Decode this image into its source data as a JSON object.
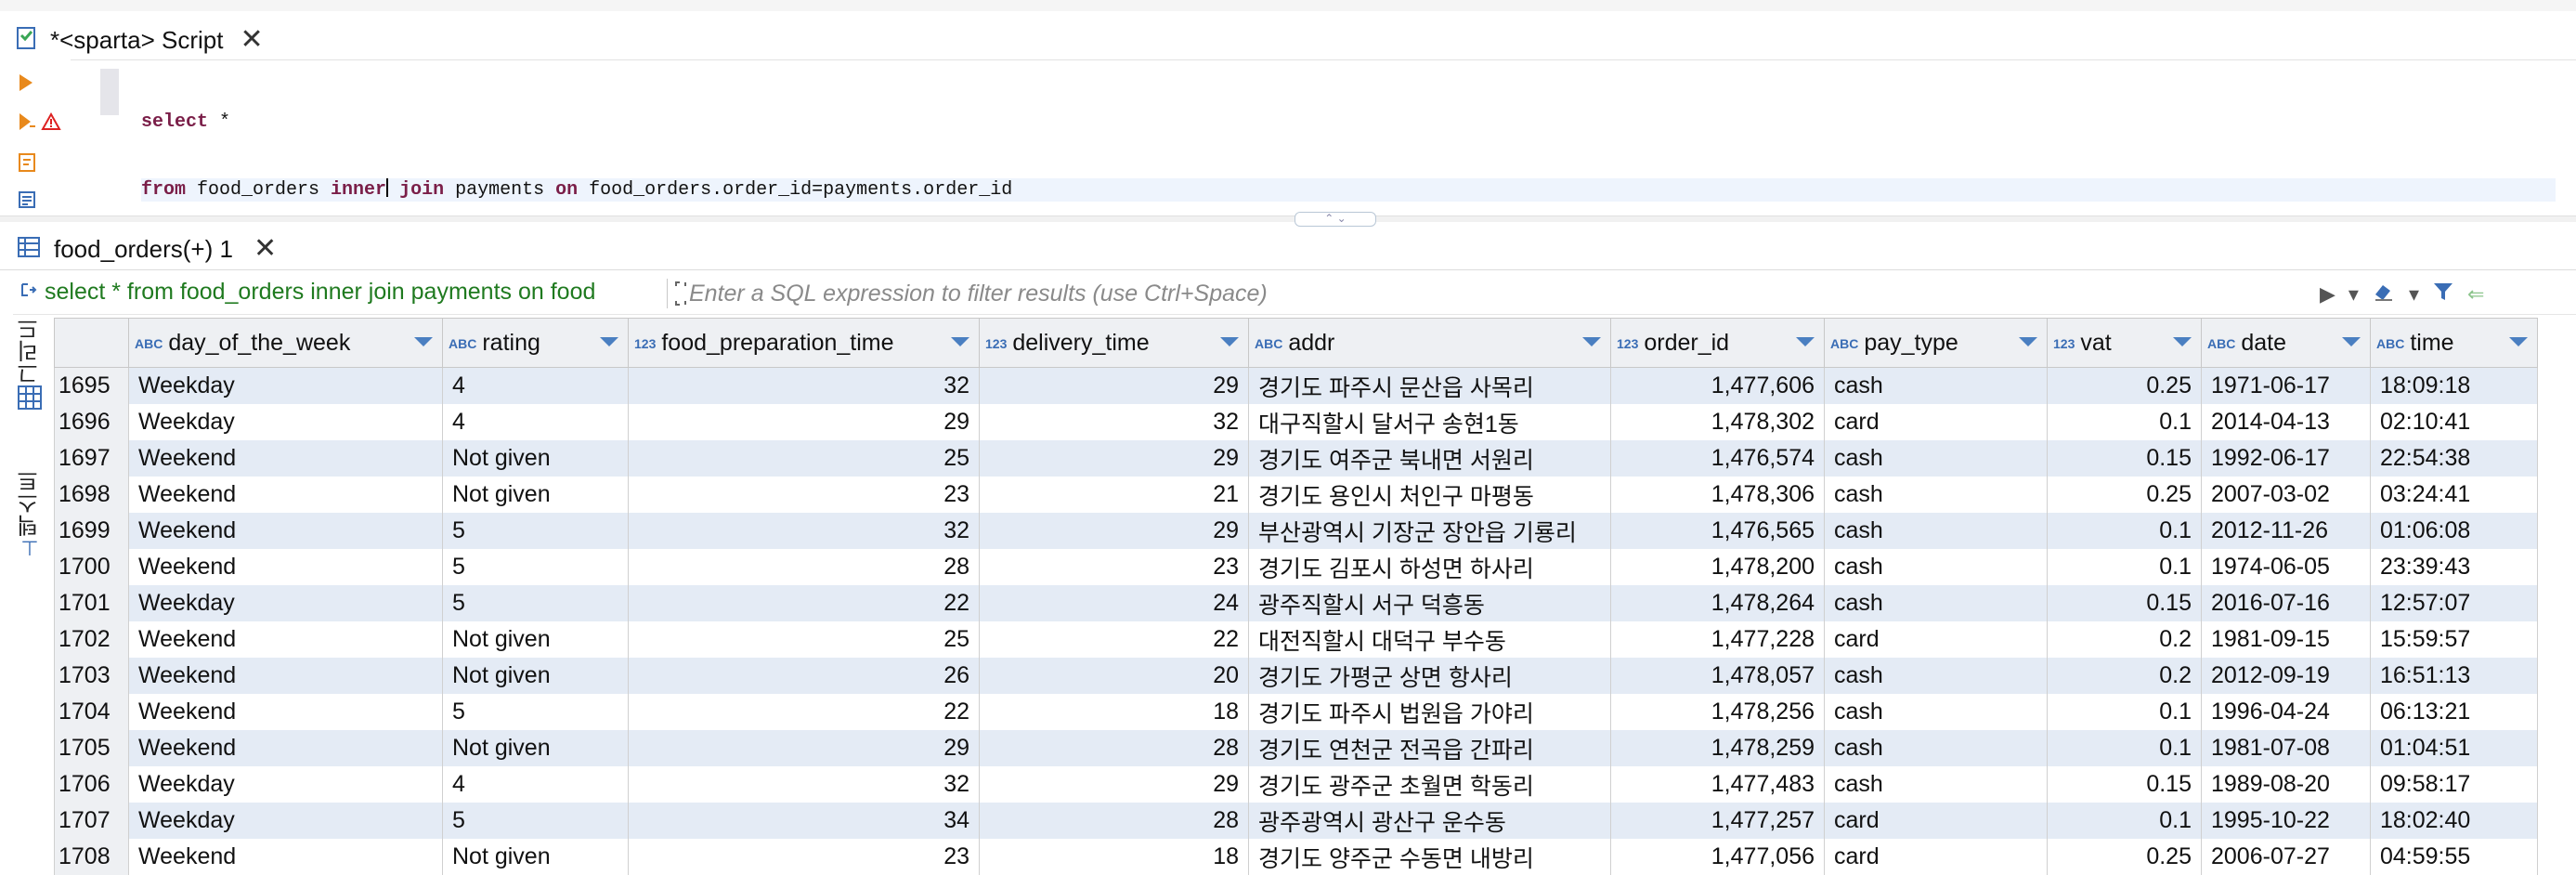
{
  "editor": {
    "tab_title": "*<sparta> Script",
    "sql_line1_kw": "select",
    "sql_line1_rest": " *",
    "sql_line2_from": "from",
    "sql_line2_table": " food_orders ",
    "sql_line2_inner": "inner",
    "sql_line2_join": " join",
    "sql_line2_payments": " payments ",
    "sql_line2_on": "on",
    "sql_line2_cond": " food_orders.order_id=payments.order_id"
  },
  "results": {
    "tab_title": "food_orders(+) 1",
    "filter_query": "select * from food_orders inner join payments on food",
    "filter_placeholder": "Enter a SQL expression to filter results (use Ctrl+Space)",
    "vtab_grid": "그리드",
    "vtab_text": "텍스트"
  },
  "colors": {
    "accent": "#4a7fc1",
    "keyword": "#7a1e48",
    "row_alt": "#e4ebf5",
    "filter_query": "#1f7a1f"
  },
  "columns": [
    {
      "type": "ABC",
      "name": "day_of_the_week"
    },
    {
      "type": "ABC",
      "name": "rating"
    },
    {
      "type": "123",
      "name": "food_preparation_time"
    },
    {
      "type": "123",
      "name": "delivery_time"
    },
    {
      "type": "ABC",
      "name": "addr"
    },
    {
      "type": "123",
      "name": "order_id"
    },
    {
      "type": "ABC",
      "name": "pay_type"
    },
    {
      "type": "123",
      "name": "vat"
    },
    {
      "type": "ABC",
      "name": "date"
    },
    {
      "type": "ABC",
      "name": "time"
    }
  ],
  "rows": [
    [
      "1695",
      "Weekday",
      "4",
      "32",
      "29",
      "경기도 파주시 문산읍 사목리",
      "1,477,606",
      "cash",
      "0.25",
      "1971-06-17",
      "18:09:18"
    ],
    [
      "1696",
      "Weekday",
      "4",
      "29",
      "32",
      "대구직할시 달서구 송현1동",
      "1,478,302",
      "card",
      "0.1",
      "2014-04-13",
      "02:10:41"
    ],
    [
      "1697",
      "Weekend",
      "Not given",
      "25",
      "29",
      "경기도 여주군 북내면 서원리",
      "1,476,574",
      "cash",
      "0.15",
      "1992-06-17",
      "22:54:38"
    ],
    [
      "1698",
      "Weekend",
      "Not given",
      "23",
      "21",
      "경기도 용인시 처인구 마평동",
      "1,478,306",
      "cash",
      "0.25",
      "2007-03-02",
      "03:24:41"
    ],
    [
      "1699",
      "Weekend",
      "5",
      "32",
      "29",
      "부산광역시 기장군 장안읍 기룡리",
      "1,476,565",
      "cash",
      "0.1",
      "2012-11-26",
      "01:06:08"
    ],
    [
      "1700",
      "Weekend",
      "5",
      "28",
      "23",
      "경기도 김포시 하성면 하사리",
      "1,478,200",
      "cash",
      "0.1",
      "1974-06-05",
      "23:39:43"
    ],
    [
      "1701",
      "Weekday",
      "5",
      "22",
      "24",
      "광주직할시 서구 덕흥동",
      "1,478,264",
      "cash",
      "0.15",
      "2016-07-16",
      "12:57:07"
    ],
    [
      "1702",
      "Weekend",
      "Not given",
      "25",
      "22",
      "대전직할시 대덕구 부수동",
      "1,477,228",
      "card",
      "0.2",
      "1981-09-15",
      "15:59:57"
    ],
    [
      "1703",
      "Weekend",
      "Not given",
      "26",
      "20",
      "경기도 가평군 상면 항사리",
      "1,478,057",
      "cash",
      "0.2",
      "2012-09-19",
      "16:51:13"
    ],
    [
      "1704",
      "Weekend",
      "5",
      "22",
      "18",
      "경기도 파주시 법원읍 가야리",
      "1,478,256",
      "cash",
      "0.1",
      "1996-04-24",
      "06:13:21"
    ],
    [
      "1705",
      "Weekend",
      "Not given",
      "29",
      "28",
      "경기도 연천군 전곡읍 간파리",
      "1,478,259",
      "cash",
      "0.1",
      "1981-07-08",
      "01:04:51"
    ],
    [
      "1706",
      "Weekday",
      "4",
      "32",
      "29",
      "경기도 광주군 초월면 학동리",
      "1,477,483",
      "cash",
      "0.15",
      "1989-08-20",
      "09:58:17"
    ],
    [
      "1707",
      "Weekday",
      "5",
      "34",
      "28",
      "광주광역시 광산구 운수동",
      "1,477,257",
      "card",
      "0.1",
      "1995-10-22",
      "18:02:40"
    ],
    [
      "1708",
      "Weekend",
      "Not given",
      "23",
      "18",
      "경기도 양주군 수동면 내방리",
      "1,477,056",
      "card",
      "0.25",
      "2006-07-27",
      "04:59:55"
    ]
  ]
}
